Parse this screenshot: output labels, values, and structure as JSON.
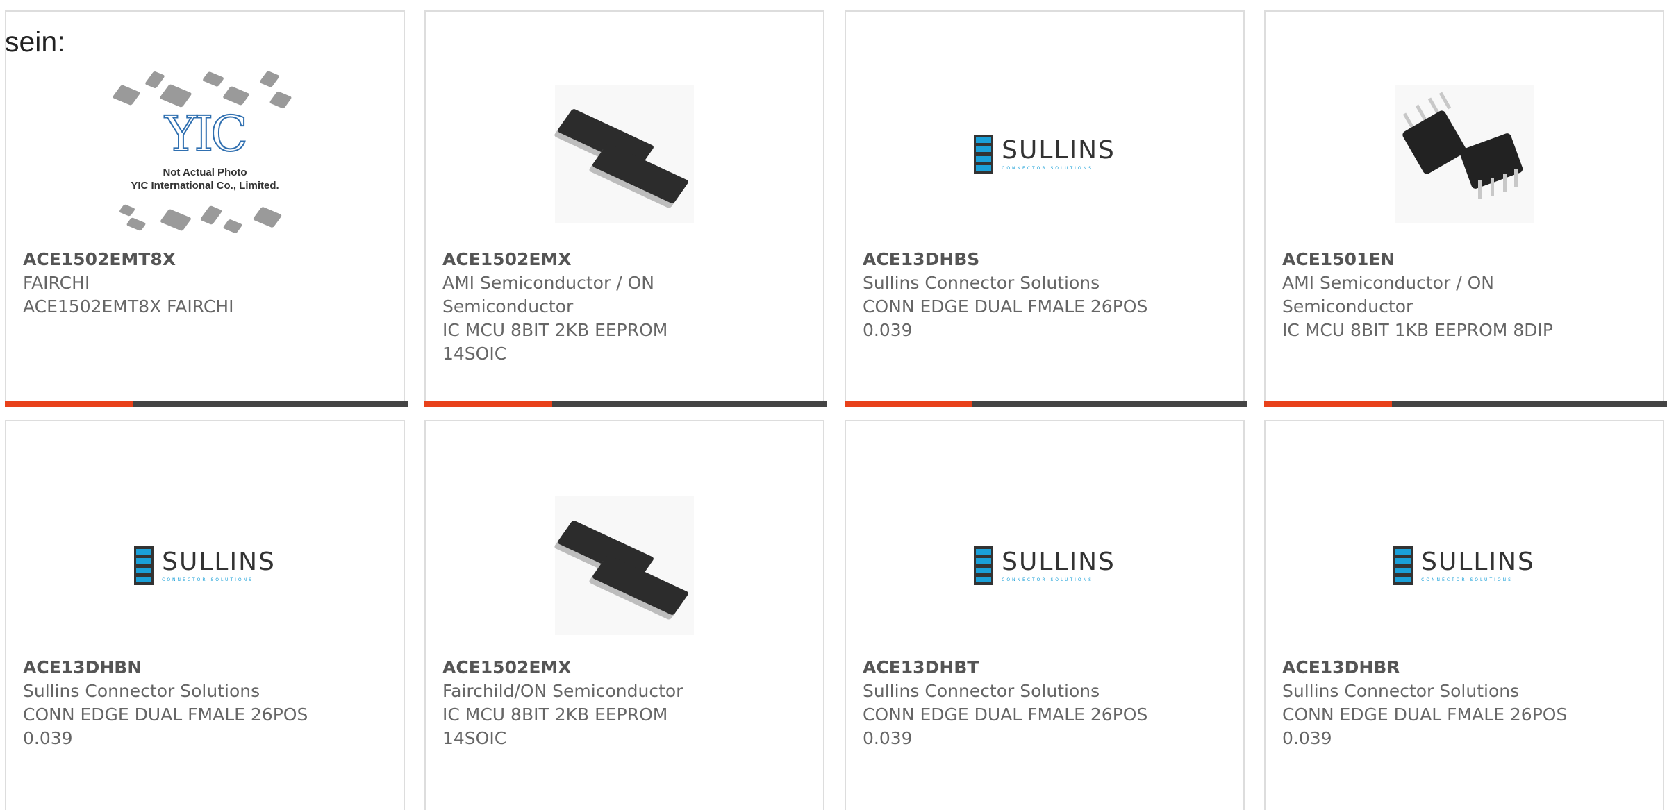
{
  "intro": {
    "text": "sein:"
  },
  "products": [
    {
      "part_number": "ACE1502EMT8X",
      "manufacturer": "FAIRCHI",
      "description": "ACE1502EMT8X FAIRCHI",
      "image": "yic-placeholder",
      "image_caption": "Not Actual Photo\nYIC International Co., Limited."
    },
    {
      "part_number": "ACE1502EMX",
      "manufacturer": "AMI Semiconductor / ON Semiconductor",
      "description": "IC MCU 8BIT 2KB EEPROM 14SOIC",
      "image": "soic-chip-photo"
    },
    {
      "part_number": "ACE13DHBS",
      "manufacturer": "Sullins Connector Solutions",
      "description": "CONN EDGE DUAL FMALE 26POS 0.039",
      "image": "sullins-logo"
    },
    {
      "part_number": "ACE1501EN",
      "manufacturer": "AMI Semiconductor / ON Semiconductor",
      "description": "IC MCU 8BIT 1KB EEPROM 8DIP",
      "image": "dip-chip-photo"
    },
    {
      "part_number": "ACE13DHBN",
      "manufacturer": "Sullins Connector Solutions",
      "description": "CONN EDGE DUAL FMALE 26POS 0.039",
      "image": "sullins-logo"
    },
    {
      "part_number": "ACE1502EMX",
      "manufacturer": "Fairchild/ON Semiconductor",
      "description": "IC MCU 8BIT 2KB EEPROM 14SOIC",
      "image": "soic-chip-photo"
    },
    {
      "part_number": "ACE13DHBT",
      "manufacturer": "Sullins Connector Solutions",
      "description": "CONN EDGE DUAL FMALE 26POS 0.039",
      "image": "sullins-logo"
    },
    {
      "part_number": "ACE13DHBR",
      "manufacturer": "Sullins Connector Solutions",
      "description": "CONN EDGE DUAL FMALE 26POS 0.039",
      "image": "sullins-logo"
    }
  ],
  "logos": {
    "sullins_name": "SULLINS",
    "sullins_tag": "CONNECTOR SOLUTIONS",
    "yic_mark": "YIC"
  },
  "colors": {
    "accent": "#e8411a",
    "bar": "#444444",
    "text": "#666666",
    "border": "#dddddd",
    "sullins_blue": "#1aa0d8"
  }
}
